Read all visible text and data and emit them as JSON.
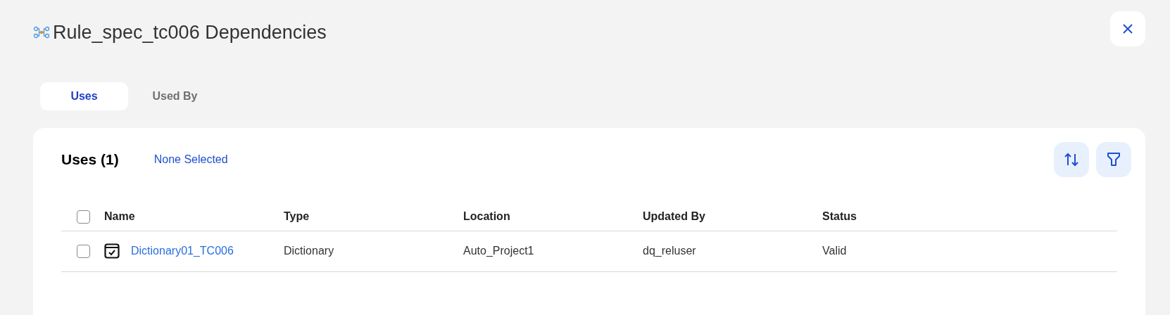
{
  "title": "Rule_spec_tc006 Dependencies",
  "tabs": [
    {
      "label": "Uses",
      "selected": true
    },
    {
      "label": "Used By",
      "selected": false
    }
  ],
  "panel": {
    "heading": "Uses (1)",
    "selection": "None Selected"
  },
  "table": {
    "select_all_checked": false,
    "columns": [
      "Name",
      "Type",
      "Location",
      "Updated By",
      "Status"
    ],
    "rows": [
      {
        "checked": false,
        "cells": [
          "Dictionary01_TC006",
          "Dictionary",
          "Auto_Project1",
          "dq_reluser",
          "Valid"
        ]
      }
    ]
  }
}
